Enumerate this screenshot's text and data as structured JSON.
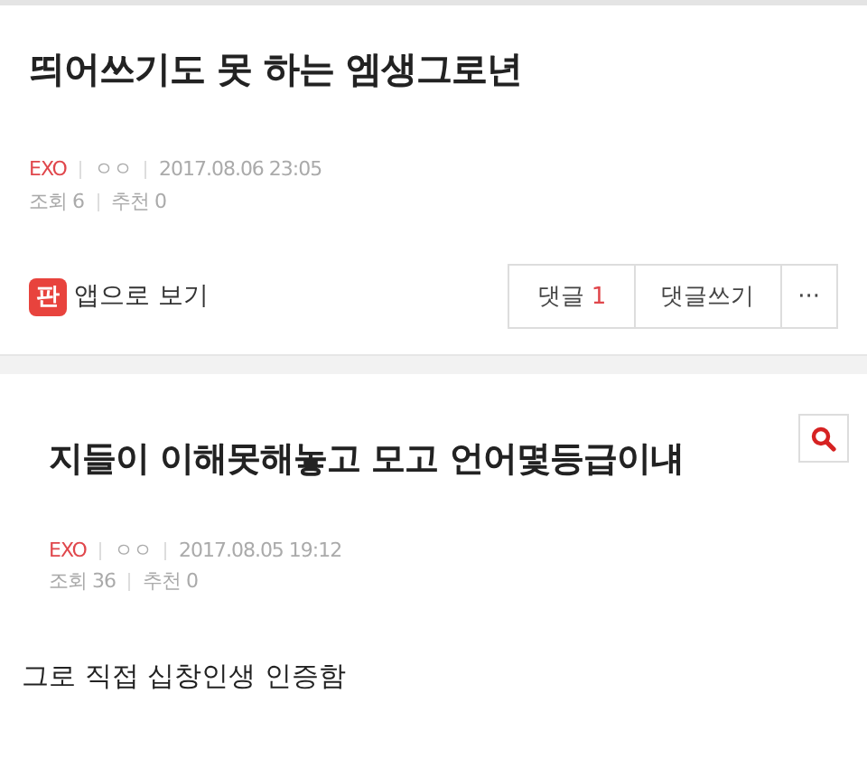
{
  "post": {
    "title": "띄어쓰기도 못 하는 엠생그로년",
    "board": "EXO",
    "author": "ㅇㅇ",
    "date": "2017.08.06 23:05",
    "views": "조회 6",
    "likes": "추천 0"
  },
  "actions": {
    "app_badge": "판",
    "app_link": "앱으로 보기",
    "comments_label": "댓글",
    "comments_count": "1",
    "write_comment": "댓글쓰기",
    "more": "···"
  },
  "quoted_post": {
    "title": "지들이 이해못해놓고 모고 언어몇등급이냬",
    "board": "EXO",
    "author": "ㅇㅇ",
    "date": "2017.08.05 19:12",
    "views": "조회 36",
    "likes": "추천 0"
  },
  "body": "그로 직접 십창인생 인증함"
}
